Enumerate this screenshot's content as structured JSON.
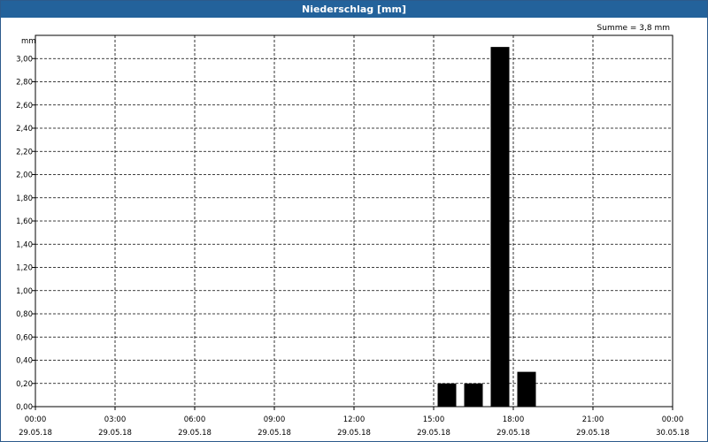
{
  "window": {
    "title": "Niederschlag [mm]"
  },
  "summary": {
    "sum_text": "Summe = 3,8 mm"
  },
  "chart_data": {
    "type": "bar",
    "title": "Niederschlag [mm]",
    "ylabel": "mm",
    "xlabel": "",
    "ylim": [
      0,
      3.2
    ],
    "xlim_hours": [
      0,
      24
    ],
    "grid": true,
    "grid_style": "dashed",
    "bar_color": "#000000",
    "y_ticks": [
      "0,00",
      "0,20",
      "0,40",
      "0,60",
      "0,80",
      "1,00",
      "1,20",
      "1,40",
      "1,60",
      "1,80",
      "2,00",
      "2,20",
      "2,40",
      "2,60",
      "2,80",
      "3,00"
    ],
    "x_ticks": [
      {
        "time": "00:00",
        "date": "29.05.18"
      },
      {
        "time": "03:00",
        "date": "29.05.18"
      },
      {
        "time": "06:00",
        "date": "29.05.18"
      },
      {
        "time": "09:00",
        "date": "29.05.18"
      },
      {
        "time": "12:00",
        "date": "29.05.18"
      },
      {
        "time": "15:00",
        "date": "29.05.18"
      },
      {
        "time": "18:00",
        "date": "29.05.18"
      },
      {
        "time": "21:00",
        "date": "29.05.18"
      },
      {
        "time": "00:00",
        "date": "30.05.18"
      }
    ],
    "bars": [
      {
        "start": "29.05.18 15:00",
        "end": "29.05.18 16:00",
        "value": 0.2
      },
      {
        "start": "29.05.18 16:00",
        "end": "29.05.18 17:00",
        "value": 0.2
      },
      {
        "start": "29.05.18 17:00",
        "end": "29.05.18 18:00",
        "value": 3.1
      },
      {
        "start": "29.05.18 18:00",
        "end": "29.05.18 19:00",
        "value": 0.3
      }
    ],
    "bar_hours": [
      15,
      16,
      17,
      18
    ]
  }
}
